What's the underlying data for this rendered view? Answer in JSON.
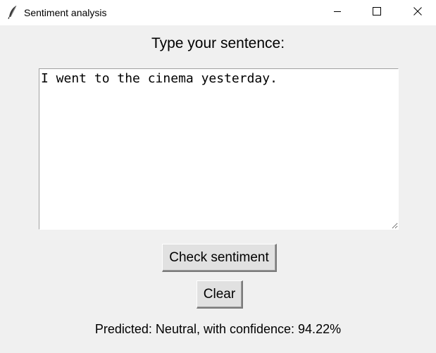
{
  "window": {
    "title": "Sentiment analysis",
    "app_icon": "feather-icon",
    "controls": {
      "minimize_icon": "minimize-icon",
      "maximize_icon": "maximize-icon",
      "close_icon": "close-icon"
    }
  },
  "main": {
    "heading": "Type your sentence:",
    "sentence_input": {
      "value": "I went to the cinema yesterday."
    },
    "check_button_label": "Check sentiment",
    "clear_button_label": "Clear",
    "result_text": "Predicted: Neutral, with confidence: 94.22%"
  },
  "colors": {
    "window_background": "#f0f0f0",
    "titlebar_background": "#ffffff",
    "button_face": "#e1e1e1",
    "text": "#000000"
  }
}
